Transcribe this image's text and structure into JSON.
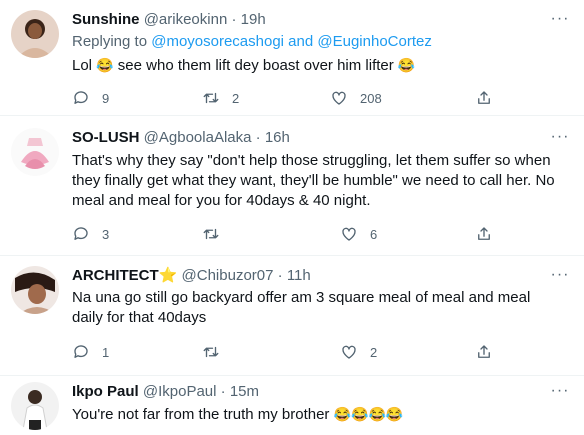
{
  "tweets": [
    {
      "name": "Sunshine",
      "handle": "@arikeokinn",
      "time": "19h",
      "replying_prefix": "Replying to ",
      "replying_user1": "@moyosorecashogi",
      "replying_and": " and ",
      "replying_user2": "@EuginhoCortez",
      "text_a": "Lol ",
      "text_b": " see who them lift dey boast over him lifter ",
      "replies": "9",
      "retweets": "2",
      "likes": "208"
    },
    {
      "name": "SO-LUSH",
      "handle": "@AgboolaAlaka",
      "time": "16h",
      "text": "That's why they say \"don't help those struggling, let them suffer so when they finally get what they want, they'll be humble\" we need to call her. No meal and meal for you for 40days & 40 night.",
      "replies": "3",
      "retweets": "",
      "likes": "6"
    },
    {
      "name": "ARCHITECT",
      "handle": "@Chibuzor07",
      "time": "11h",
      "text": "Na una go still go backyard offer am 3 square meal of meal and meal daily for that 40days",
      "replies": "1",
      "retweets": "",
      "likes": "2"
    },
    {
      "name": "Ikpo Paul",
      "handle": "@IkpoPaul",
      "time": "15m",
      "text": "You're not far from the truth my brother "
    }
  ],
  "separator": " · ",
  "emoji_laugh": "😂",
  "emoji_star": "⭐",
  "more_glyph": "···",
  "icons": {
    "reply": "reply-icon",
    "retweet": "retweet-icon",
    "like": "like-icon",
    "share": "share-icon"
  }
}
